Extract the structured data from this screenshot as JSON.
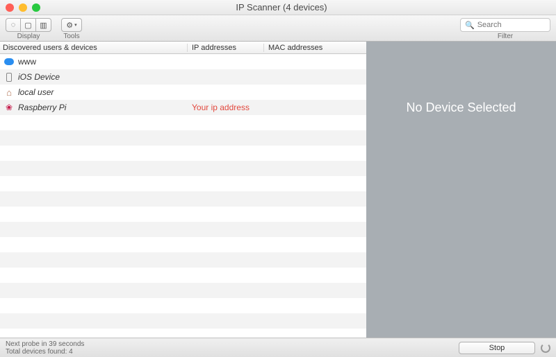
{
  "window": {
    "title": "IP Scanner (4 devices)"
  },
  "toolbar": {
    "display_label": "Display",
    "tools_label": "Tools",
    "filter_label": "Filter",
    "search_placeholder": "Search"
  },
  "columns": {
    "devices": "Discovered users & devices",
    "ip": "IP addresses",
    "mac": "MAC addresses"
  },
  "devices": [
    {
      "name": "www",
      "icon": "globe",
      "ip": "",
      "mac": "",
      "italic": false
    },
    {
      "name": "iOS Device",
      "icon": "phone",
      "ip": "",
      "mac": "",
      "italic": true
    },
    {
      "name": "local user",
      "icon": "house",
      "ip": "",
      "mac": "",
      "italic": true
    },
    {
      "name": "Raspberry Pi",
      "icon": "raspberry",
      "ip": "Your ip address",
      "mac": "",
      "italic": true,
      "ip_red": true
    }
  ],
  "detail": {
    "empty": "No Device Selected"
  },
  "footer": {
    "probe": "Next probe in 39 seconds",
    "total": "Total devices found: 4",
    "stop": "Stop"
  }
}
